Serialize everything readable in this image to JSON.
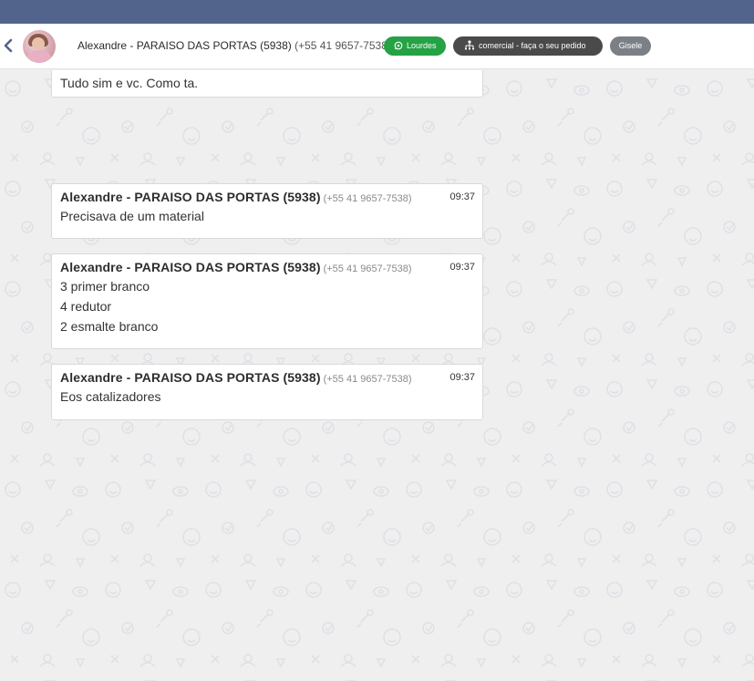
{
  "header": {
    "contact_name": "Alexandre - PARAISO DAS PORTAS (5938)",
    "contact_phone": "(+55 41 9657-7538)",
    "whatsapp_tag": "Lourdes",
    "department_tag": "comercial - faça o seu pedido",
    "agent_tag": "Gisele",
    "icons": [
      "chevron-left-icon",
      "whatsapp-icon",
      "org-chart-icon"
    ]
  },
  "colors": {
    "top_bar": "#53648c",
    "whatsapp_pill": "#25a244",
    "department_pill": "#4a4a4a",
    "agent_pill": "#7b7f86",
    "chat_background": "#efefef"
  },
  "messages": [
    {
      "lines": [
        "Tudo sim e vc. Como ta."
      ]
    },
    {
      "sender": "Alexandre - PARAISO DAS PORTAS (5938)",
      "phone": "(+55 41 9657-7538)",
      "time": "09:37",
      "lines": [
        "Precisava de um material"
      ]
    },
    {
      "sender": "Alexandre - PARAISO DAS PORTAS (5938)",
      "phone": "(+55 41 9657-7538)",
      "time": "09:37",
      "lines": [
        "3 primer branco",
        "4 redutor",
        "2 esmalte branco"
      ]
    },
    {
      "sender": "Alexandre - PARAISO DAS PORTAS (5938)",
      "phone": "(+55 41 9657-7538)",
      "time": "09:37",
      "lines": [
        "Eos catalizadores"
      ]
    }
  ]
}
